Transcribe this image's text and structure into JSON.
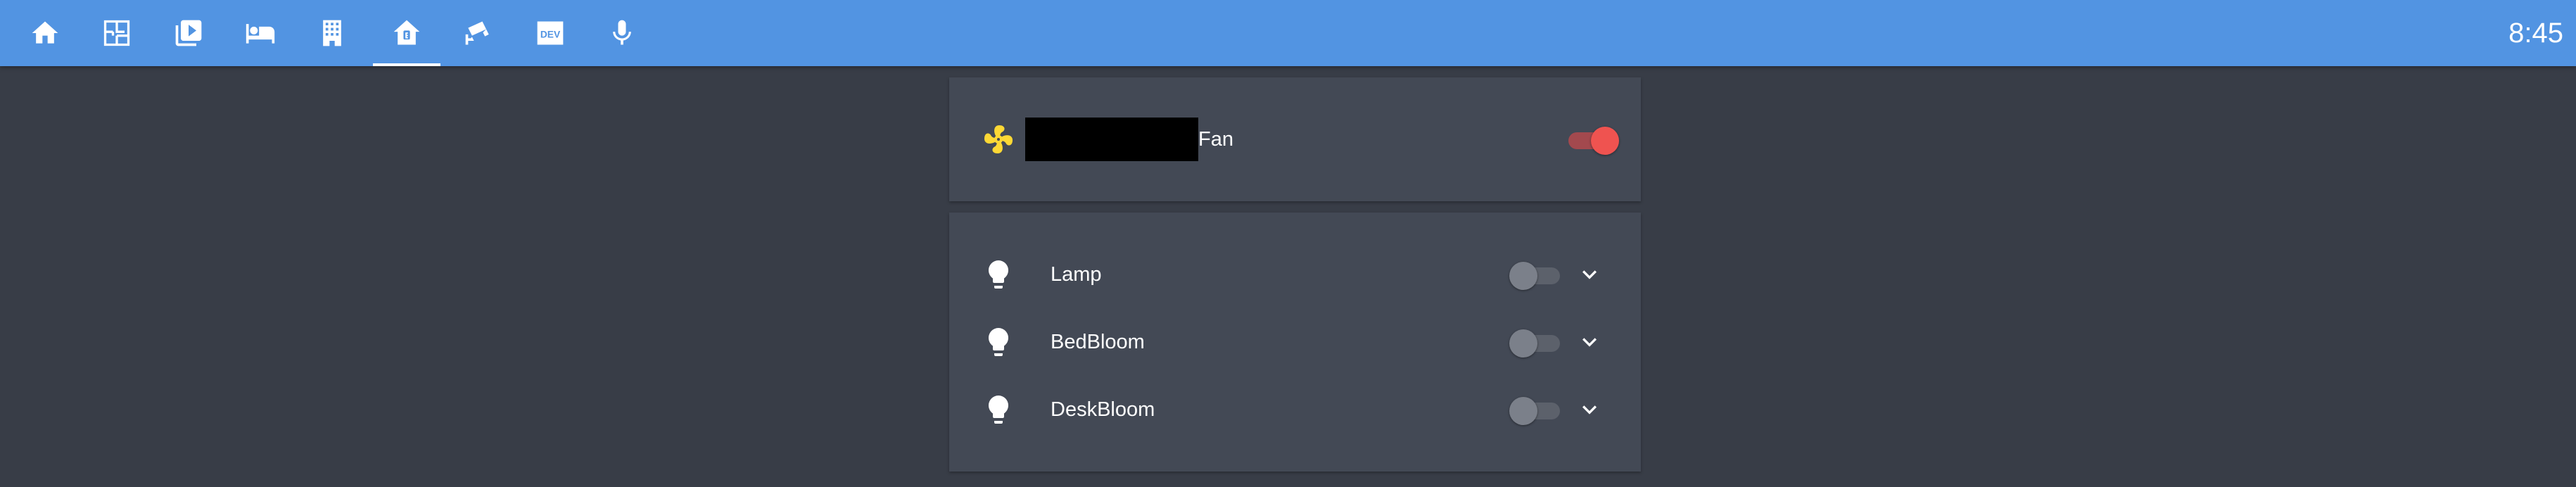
{
  "header": {
    "tabs": [
      {
        "icon": "home-icon"
      },
      {
        "icon": "floorplan-icon"
      },
      {
        "icon": "media-playlist-icon"
      },
      {
        "icon": "bed-icon"
      },
      {
        "icon": "office-building-icon"
      },
      {
        "icon": "home-badge-icon",
        "active": true
      },
      {
        "icon": "security-camera-icon"
      },
      {
        "icon": "dev-icon",
        "text": "DEV"
      },
      {
        "icon": "microphone-icon"
      }
    ],
    "time": "8:45",
    "background_color": "#5294e2"
  },
  "fan_card": {
    "label": "Fan",
    "state": "on",
    "icon": "fan-icon",
    "icon_color": "#fdd835",
    "toggle_color": "#ef5350"
  },
  "lights_card": {
    "items": [
      {
        "label": "Lamp",
        "icon": "lightbulb-icon",
        "state": "off"
      },
      {
        "label": "BedBloom",
        "icon": "lightbulb-icon",
        "state": "off"
      },
      {
        "label": "DeskBloom",
        "icon": "lightbulb-icon",
        "state": "off"
      }
    ]
  },
  "theme": {
    "page_background": "#383d47",
    "card_background": "#434955",
    "text_color": "#ffffff"
  }
}
